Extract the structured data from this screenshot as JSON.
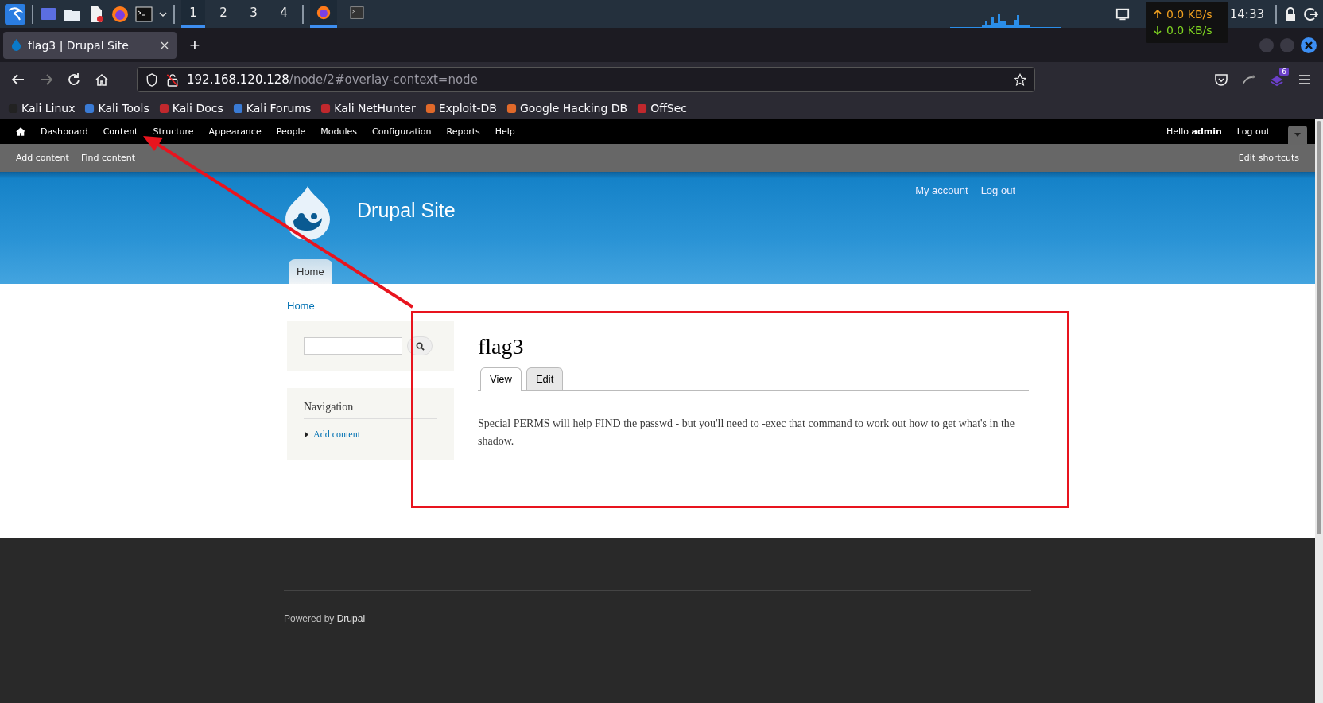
{
  "taskbar": {
    "workspaces": [
      {
        "label": "1",
        "selected": true
      },
      {
        "label": "2",
        "selected": false
      },
      {
        "label": "3",
        "selected": false
      },
      {
        "label": "4",
        "selected": false
      }
    ],
    "clock": "14:33"
  },
  "net_speed": {
    "up": "0.0 KB/s",
    "down": "0.0 KB/s"
  },
  "browser": {
    "tab_title": "flag3 | Drupal Site",
    "new_tab": "+",
    "url_host": "192.168.120.128",
    "url_path": "/node/2#overlay-context=node",
    "extensions_badge": "6",
    "bookmarks": [
      "Kali Linux",
      "Kali Tools",
      "Kali Docs",
      "Kali Forums",
      "Kali NetHunter",
      "Exploit-DB",
      "Google Hacking DB",
      "OffSec"
    ]
  },
  "admin_menu": {
    "items": [
      "Dashboard",
      "Content",
      "Structure",
      "Appearance",
      "People",
      "Modules",
      "Configuration",
      "Reports",
      "Help"
    ],
    "greeting": "Hello **admin**",
    "logout": "Log out"
  },
  "shortcuts": {
    "items": [
      "Add content",
      "Find content"
    ],
    "edit": "Edit shortcuts"
  },
  "site": {
    "name": "Drupal Site",
    "user_links": [
      "My account",
      "Log out"
    ],
    "main_menu": [
      {
        "label": "Home",
        "selected": true
      }
    ]
  },
  "breadcrumb": "Home",
  "sidebar": {
    "navigation_title": "Navigation",
    "navigation_items": [
      "Add content"
    ]
  },
  "node": {
    "title": "flag3",
    "tabs": [
      {
        "label": "View",
        "selected": true
      },
      {
        "label": "Edit",
        "selected": false
      }
    ],
    "body": "Special PERMS will help FIND the passwd - but you'll need to -exec that command to work out how to get what's in the shadow."
  },
  "footer": {
    "prefix": "Powered by",
    "link": "Drupal"
  }
}
